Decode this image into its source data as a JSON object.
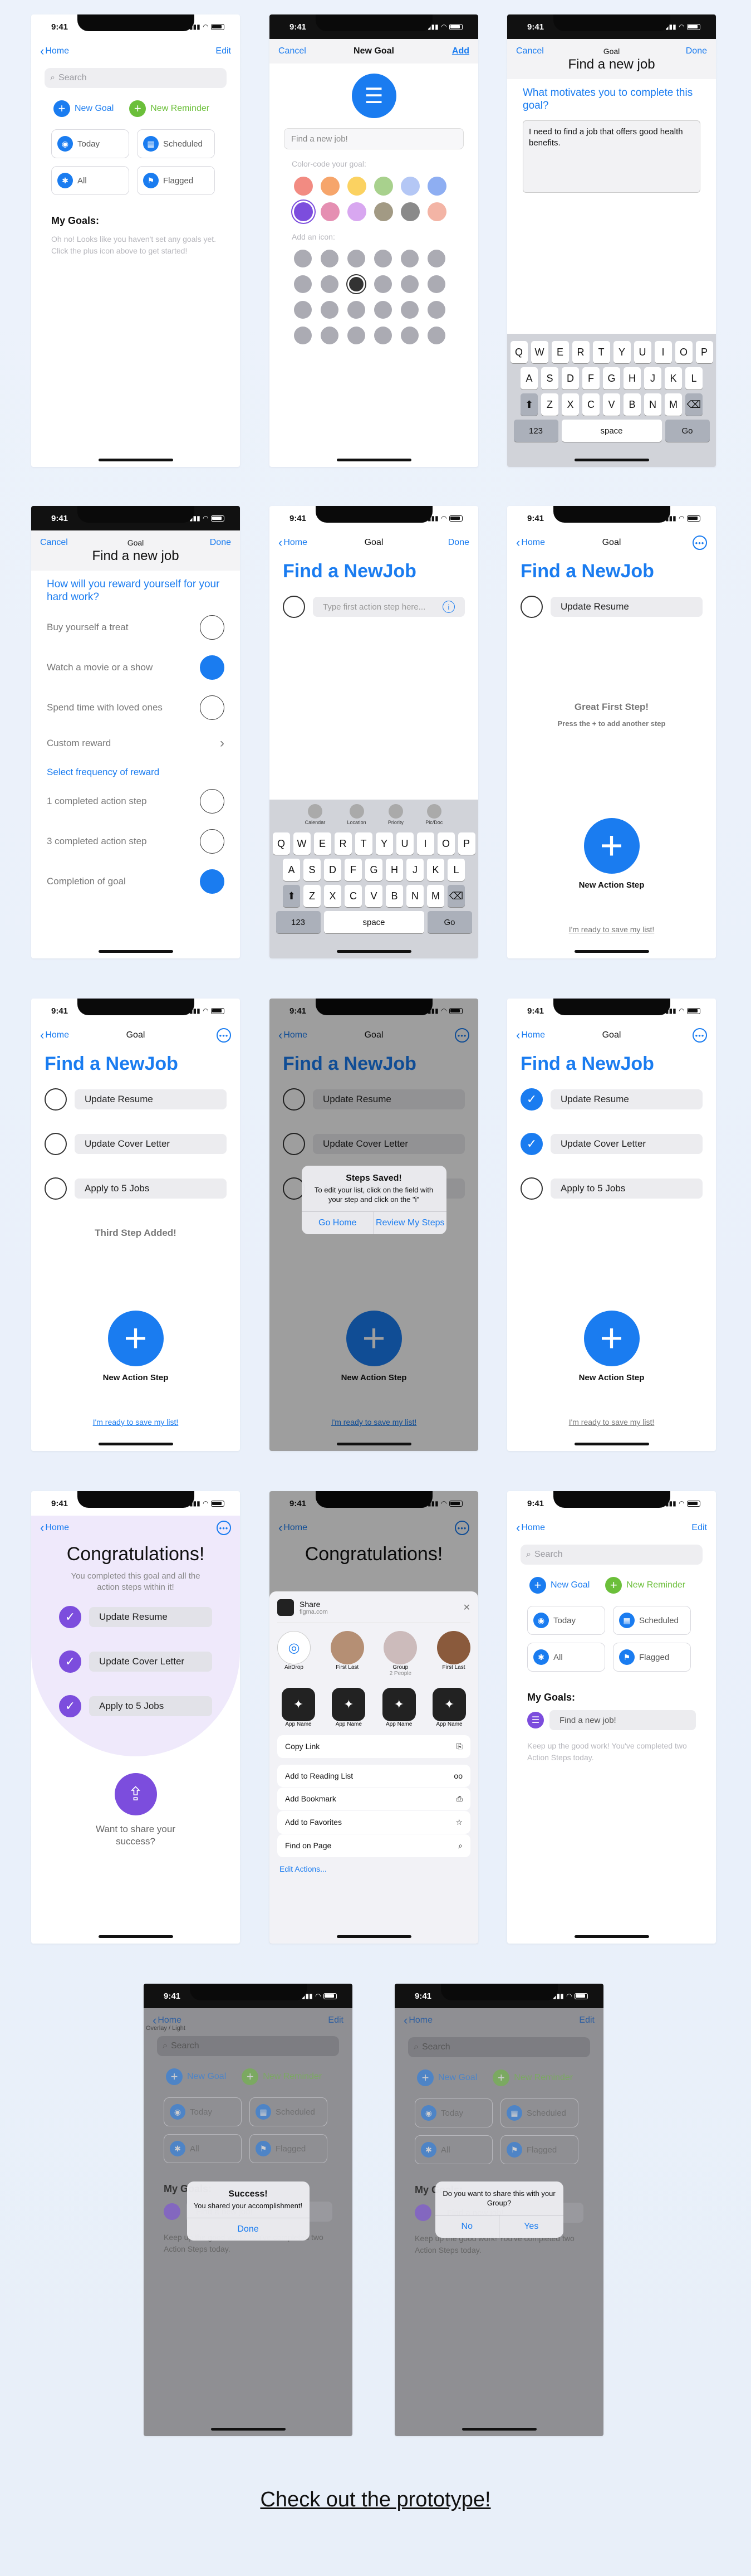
{
  "status": {
    "time": "9:41"
  },
  "s1": {
    "back": "Home",
    "edit": "Edit",
    "search_placeholder": "Search",
    "new_goal": "New Goal",
    "new_reminder": "New Reminder",
    "tiles": [
      "Today",
      "Scheduled",
      "All",
      "Flagged"
    ],
    "my_goals": "My Goals:",
    "empty": "Oh no! Looks like you haven't set any goals yet. Click the plus icon above to get started!"
  },
  "s2": {
    "cancel": "Cancel",
    "title": "New Goal",
    "add": "Add",
    "placeholder": "Find a new job!",
    "color_label": "Color-code your goal:",
    "icon_label": "Add an icon:",
    "swatches": [
      "#f28b82",
      "#f6a56b",
      "#fbd261",
      "#a8d18d",
      "#b4c7f5",
      "#8eaef2",
      "#7c4ddd",
      "#e58fb2",
      "#d8a7f0",
      "#a29a84",
      "#8a8a8a",
      "#f3b4a5"
    ]
  },
  "s3": {
    "cancel": "Cancel",
    "small_title": "Goal",
    "done": "Done",
    "title": "Find a new job",
    "question": "What motivates you to complete this goal?",
    "answer": "I need to find a job that offers good health benefits."
  },
  "s4": {
    "cancel": "Cancel",
    "small_title": "Goal",
    "done": "Done",
    "title": "Find a new job",
    "question": "How will you reward yourself for your hard work?",
    "rewards": [
      "Buy yourself a treat",
      "Watch a movie or a show",
      "Spend time with loved ones",
      "Custom reward"
    ],
    "freq_label": "Select frequency of reward",
    "freqs": [
      "1 completed action step",
      "3 completed action step",
      "Completion of goal"
    ]
  },
  "s5": {
    "back": "Home",
    "title": "Goal",
    "done": "Done",
    "big": "Find a NewJob",
    "placeholder": "Type first action step here...",
    "suggest": [
      "Calendar",
      "Location",
      "Priority",
      "Pic/Doc"
    ]
  },
  "s6": {
    "back": "Home",
    "title": "Goal",
    "big": "Find a NewJob",
    "step1": "Update Resume",
    "note": "Great First Step!",
    "sub": "Press the + to add another step",
    "fab_label": "New Action Step",
    "save": "I'm ready to save my list!"
  },
  "s7": {
    "steps": [
      "Update Resume",
      "Update Cover Letter",
      "Apply to 5 Jobs"
    ],
    "note": "Third Step Added!"
  },
  "s8": {
    "alert_title": "Steps Saved!",
    "alert_msg": "To edit your list, click on the field with your step and click on the \"i\"",
    "btn1": "Go Home",
    "btn2": "Review My Steps"
  },
  "s10": {
    "title": "Congratulations!",
    "msg": "You completed this goal and all the action steps within it!",
    "share_q": "Want to share your success?"
  },
  "s11": {
    "share": "Share",
    "share_sub": "figma.com",
    "people": [
      "AirDrop",
      "First Last",
      "Group",
      "First Last"
    ],
    "group_sub": "2 People",
    "apps": [
      "App Name",
      "App Name",
      "App Name",
      "App Name"
    ],
    "actions": [
      "Copy Link",
      "Add to Reading List",
      "Add Bookmark",
      "Add to Favorites",
      "Find on Page"
    ],
    "edit_actions": "Edit Actions..."
  },
  "s12": {
    "goal_item": "Find a new job!",
    "keep_up": "Keep up the good work! You've completed two Action Steps today."
  },
  "s13": {
    "subtitle": "Overlay / Light",
    "alert_title": "Success!",
    "alert_msg": "You shared your accomplishment!",
    "btn": "Done"
  },
  "s14": {
    "alert_msg": "Do you want to share this with your Group?",
    "no": "No",
    "yes": "Yes"
  },
  "cta": "Check out the prototype!"
}
